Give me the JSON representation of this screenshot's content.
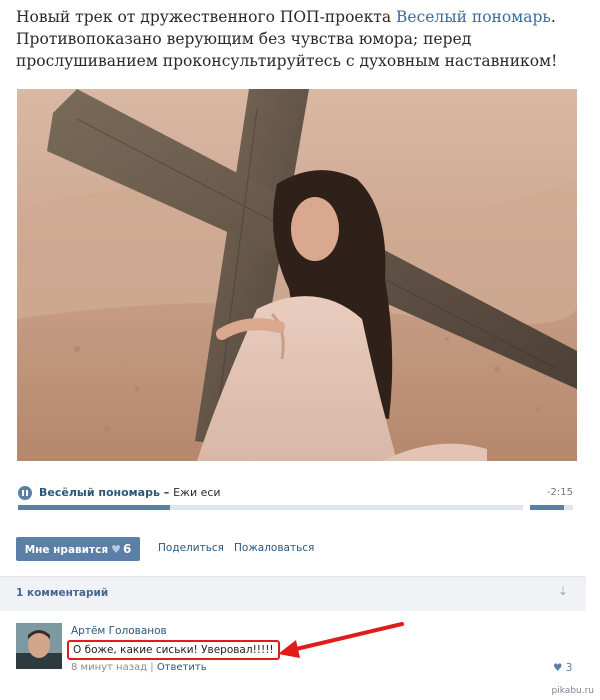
{
  "post": {
    "line1_before": "Новый трек от дружественного ПОП-проекта ",
    "line1_link": "Веселый пономарь",
    "line1_after": ".",
    "line2": "Противопоказано верующим без чувства юмора; перед прослушиванием проконсультируйтесь с духовным наставником!"
  },
  "audio": {
    "artist": "Весёлый пономарь",
    "separator": " – ",
    "title": "Ежи еси",
    "time": "-2:15",
    "progress": 0.3,
    "volume": 0.8,
    "state_icon": "pause-icon"
  },
  "actions": {
    "like_label": "Мне нравится",
    "like_count": "6",
    "share_label": "Поделиться",
    "report_label": "Пожаловаться"
  },
  "comments": {
    "count_label": "1 комментарий",
    "collapse_icon": "collapse-arrows-icon",
    "items": [
      {
        "author": "Артём Голованов",
        "text": "О боже, какие сиськи! Уверовал!!!!!",
        "time": "8 минут назад",
        "separator": " | ",
        "reply_label": "Ответить",
        "likes": "3"
      }
    ]
  },
  "watermark": "pikabu.ru",
  "colors": {
    "link": "#2b587a",
    "accent": "#5b7fa6",
    "highlight_red": "#e01b1b"
  }
}
